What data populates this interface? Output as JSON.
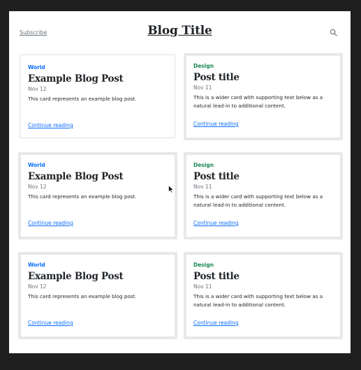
{
  "header": {
    "subscribe_label": "Subscribe",
    "blog_title": "Blog Title",
    "search_icon": "search-icon"
  },
  "cards": [
    {
      "category": "World",
      "title": "Example Blog Post",
      "date": "Nov 12",
      "text": "This card represents an example blog post.",
      "link": "Continue reading"
    },
    {
      "category": "Design",
      "title": "Post title",
      "date": "Nov 11",
      "text": "This is a wider card with supporting text below as a natural lead-in to additional content.",
      "link": "Continue reading"
    },
    {
      "category": "World",
      "title": "Example Blog Post",
      "date": "Nov 12",
      "text": "This card represents an example blog post.",
      "link": "Continue reading"
    },
    {
      "category": "Design",
      "title": "Post title",
      "date": "Nov 11",
      "text": "This is a wider card with supporting text below as a natural lead-in to additional content.",
      "link": "Continue reading"
    },
    {
      "category": "World",
      "title": "Example Blog Post",
      "date": "Nov 12",
      "text": "This card represents an example blog post.",
      "link": "Continue reading"
    },
    {
      "category": "Design",
      "title": "Post title",
      "date": "Nov 11",
      "text": "This is a wider card with supporting text below as a natural lead-in to additional content.",
      "link": "Continue reading"
    }
  ],
  "colors": {
    "world_category": "#0d6efd",
    "design_category": "#198754",
    "link": "#0d6efd",
    "background_frame": "#1f1f1f"
  }
}
